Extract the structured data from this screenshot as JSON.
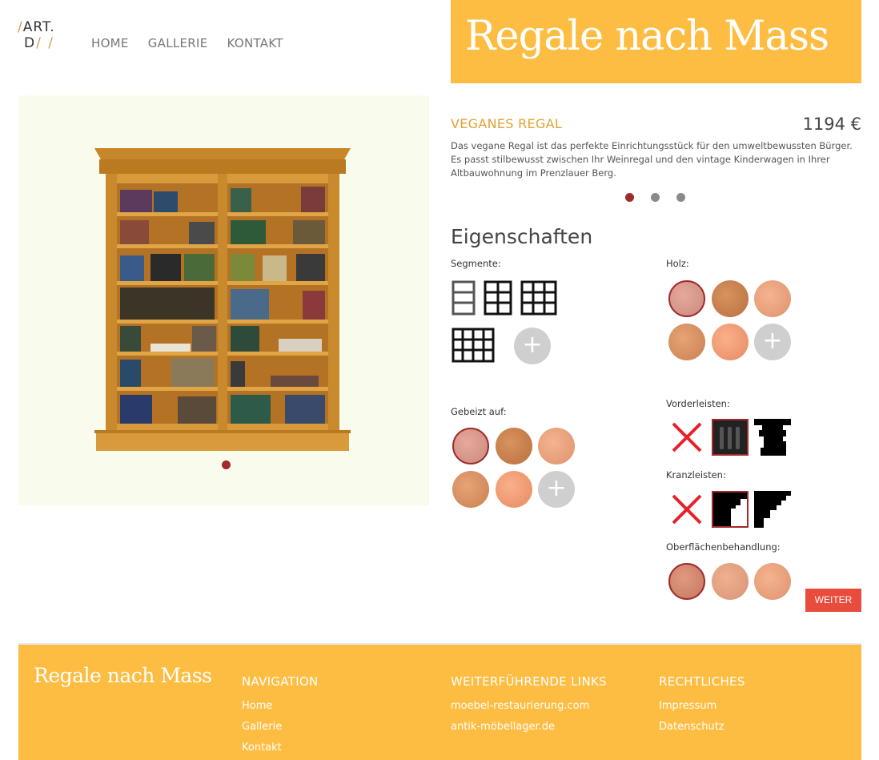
{
  "logo": {
    "line1_slash": "/",
    "line1": "ART.",
    "line2": "D",
    "line2_slashes": "/ /"
  },
  "nav": [
    "HOME",
    "GALLERIE",
    "KONTAKT"
  ],
  "hero_title": "Regale nach Mass",
  "product": {
    "title": "VEGANES REGAL",
    "price": "1194 €",
    "description": "Das vegane Regal ist das perfekte Einrichtungsstück für den umweltbewussten Bürger. Es passt stilbewusst zwischen Ihr Weinregal und den vintage Kinderwagen in Ihrer Altbauwohnung im Prenzlauer Berg.",
    "slider_active": 1,
    "slider_count": 3
  },
  "properties": {
    "heading": "Eigenschaften",
    "segmente": "Segmente:",
    "holz": "Holz:",
    "gebeizt": "Gebeizt auf:",
    "vorderleisten": "Vorderleisten:",
    "kranzleisten": "Kranzleisten:",
    "oberflaeche": "Oberflächenbehandlung:",
    "plus": "+"
  },
  "weiter": "WEITER",
  "colors": {
    "accent": "#fdbd42",
    "selected": "#a12a2a",
    "button": "#e94c3d"
  },
  "footer": {
    "brand": "Regale nach Mass",
    "columns": [
      {
        "title": "NAVIGATION",
        "links": [
          "Home",
          "Gallerie",
          "Kontakt"
        ]
      },
      {
        "title": "WEITERFÜHRENDE LINKS",
        "links": [
          "moebel-restaurierung.com",
          "antik-möbellager.de"
        ]
      },
      {
        "title": "RECHTLICHES",
        "links": [
          "Impressum",
          "Datenschutz"
        ]
      }
    ]
  }
}
